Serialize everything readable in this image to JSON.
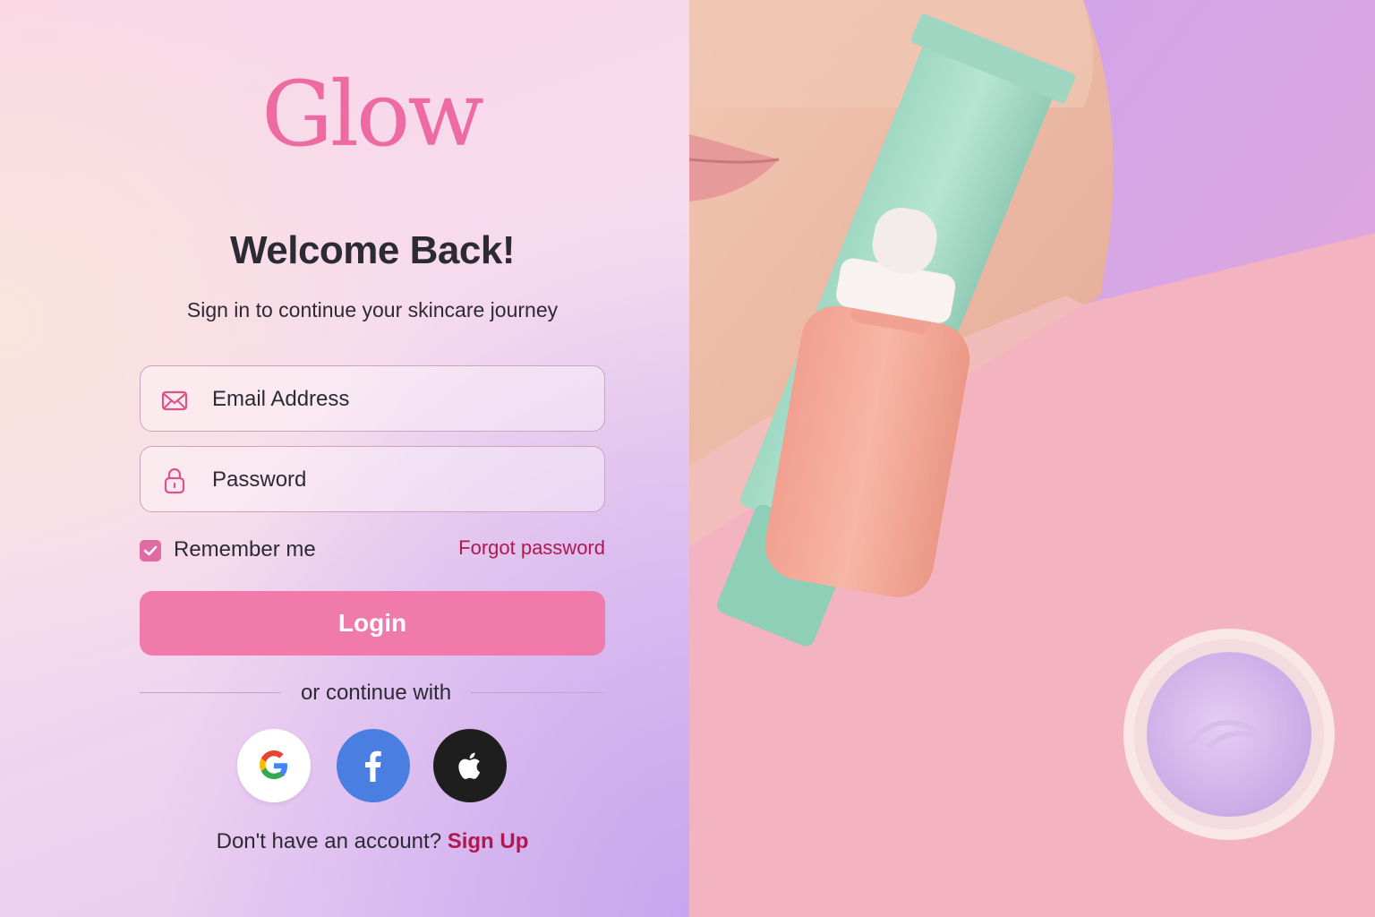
{
  "brand": {
    "logo": "Glow",
    "accent": "#ee6aa2",
    "link_color": "#b0184f"
  },
  "auth": {
    "heading": "Welcome Back!",
    "subtitle": "Sign in to continue your skincare journey",
    "email": {
      "placeholder": "Email Address",
      "value": "",
      "icon": "envelope-icon"
    },
    "password": {
      "placeholder": "Password",
      "value": "",
      "icon": "lock-icon"
    },
    "remember_me": {
      "label": "Remember me",
      "checked": true
    },
    "forgot_link": "Forgot password",
    "login_button": "Login",
    "divider_text": "or continue with",
    "social": [
      {
        "provider": "google",
        "icon": "google-icon"
      },
      {
        "provider": "facebook",
        "icon": "facebook-icon"
      },
      {
        "provider": "apple",
        "icon": "apple-icon"
      }
    ],
    "signup_prompt": "Don't have an account?",
    "signup_link": "Sign Up"
  },
  "hero": {
    "image": "skincare-products-photo",
    "colors": {
      "tube": "#a8ddc8",
      "serum": "#f4a898",
      "cream": "#d9b9ec",
      "background": "#f4b3c0"
    }
  }
}
